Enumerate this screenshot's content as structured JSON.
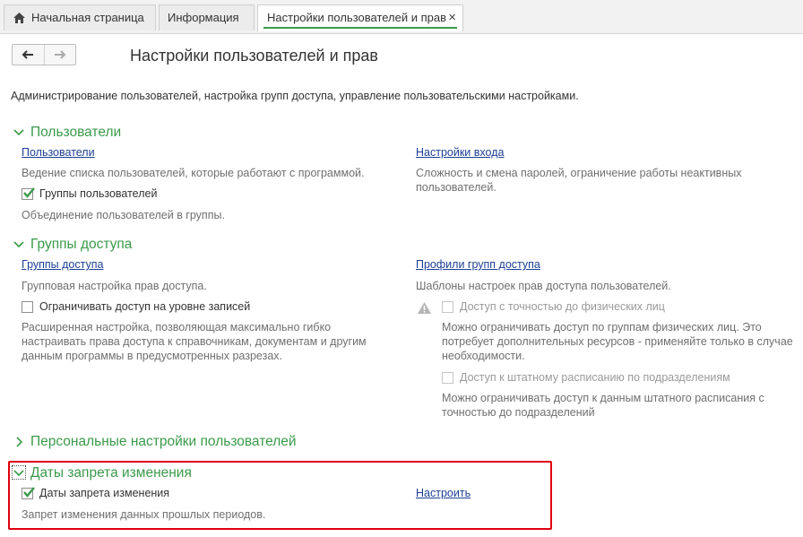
{
  "tabs": {
    "home": "Начальная страница",
    "info": "Информация",
    "active": "Настройки пользователей и прав",
    "close_glyph": "×"
  },
  "nav": {
    "back_glyph": "🡐",
    "forward_glyph": "🡒"
  },
  "page": {
    "title": "Настройки пользователей и прав",
    "subtitle": "Администрирование пользователей, настройка групп доступа, управление пользовательскими настройками."
  },
  "users": {
    "header": "Пользователи",
    "link_users": "Пользователи",
    "desc_users": "Ведение списка пользователей, которые работают с программой.",
    "chk_groups": "Группы пользователей",
    "desc_groups": "Объединение пользователей в группы.",
    "link_login": "Настройки входа",
    "desc_login": "Сложность и смена паролей, ограничение работы неактивных пользователей."
  },
  "access": {
    "header": "Группы доступа",
    "link_groups": "Группы доступа",
    "desc_groups": "Групповая настройка прав доступа.",
    "chk_records": "Ограничивать доступ на уровне записей",
    "desc_records": "Расширенная настройка, позволяющая максимально гибко настраивать права доступа к справочникам, документам и другим данным программы в предусмотренных разрезах.",
    "link_profiles": "Профили групп доступа",
    "desc_profiles": "Шаблоны настроек прав доступа пользователей.",
    "chk_individuals": "Доступ с точностью до физических лиц",
    "desc_individuals": "Можно ограничивать доступ по группам физических лиц. Это потребует дополнительных ресурсов - применяйте только в случае необходимости.",
    "chk_staff": "Доступ к штатному расписанию по подразделениям",
    "desc_staff": "Можно ограничивать доступ к данным штатного расписания с точностью до подразделений"
  },
  "personal": {
    "header": "Персональные настройки пользователей"
  },
  "dates": {
    "header": "Даты запрета изменения",
    "chk_dates": "Даты запрета изменения",
    "link_setup": "Настроить",
    "desc_dates": "Запрет изменения данных прошлых периодов."
  },
  "colors": {
    "accent": "#3a9a4a",
    "link": "#1c3f94",
    "highlight": "#e0000f"
  }
}
